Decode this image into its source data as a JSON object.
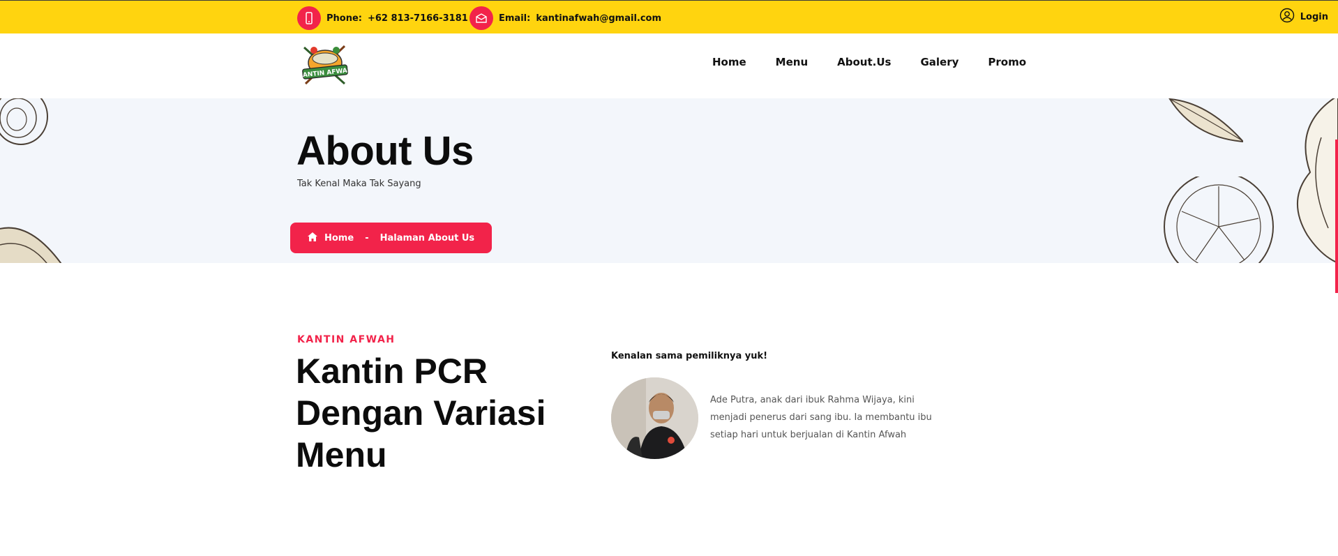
{
  "topbar": {
    "phone_label": "Phone:",
    "phone_value": "+62 813-7166-3181",
    "email_label": "Email:",
    "email_value": "kantinafwah@gmail.com",
    "login_label": "Login"
  },
  "header": {
    "logo_text": "KANTIN AFWAH",
    "nav": [
      "Home",
      "Menu",
      "About.Us",
      "Galery",
      "Promo"
    ]
  },
  "hero": {
    "title": "About Us",
    "subtitle": "Tak Kenal Maka Tak Sayang",
    "breadcrumb_home": "Home",
    "breadcrumb_sep": "-",
    "breadcrumb_current": "Halaman About Us"
  },
  "content": {
    "kicker": "KANTIN AFWAH",
    "headline": "Kantin PCR Dengan Variasi Menu",
    "owner_title": "Kenalan sama pemiliknya yuk!",
    "owner_desc": "Ade Putra, anak dari ibuk Rahma Wijaya, kini menjadi penerus dari sang ibu. Ia membantu ibu setiap hari untuk berjualan di Kantin Afwah"
  },
  "colors": {
    "accent": "#f2234a",
    "topbar": "#ffd40f",
    "hero_bg": "#f3f6fb"
  }
}
